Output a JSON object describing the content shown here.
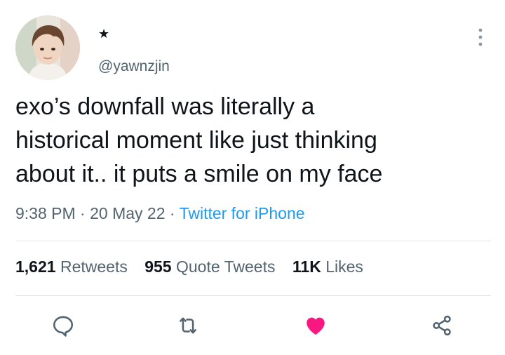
{
  "author": {
    "display_name": "★",
    "handle": "@yawnzjin"
  },
  "tweet": {
    "text_lines": [
      "exo’s downfall was literally a",
      "historical moment like just thinking",
      "about it.. it puts a smile on my face"
    ],
    "time": "9:38 PM",
    "date": "20 May 22",
    "separator": "·",
    "source": "Twitter for iPhone"
  },
  "stats": {
    "retweets": {
      "count": "1,621",
      "label": "Retweets"
    },
    "quote_tweets": {
      "count": "955",
      "label": "Quote Tweets"
    },
    "likes": {
      "count": "11K",
      "label": "Likes"
    }
  },
  "actions": [
    {
      "name": "reply",
      "icon": "reply-icon"
    },
    {
      "name": "retweet",
      "icon": "retweet-icon"
    },
    {
      "name": "like",
      "icon": "heart-icon",
      "liked": true
    },
    {
      "name": "share",
      "icon": "share-icon"
    }
  ],
  "colors": {
    "text": "#0f1419",
    "secondary": "#536471",
    "link": "#1d9bf0",
    "like": "#f91880",
    "divider": "#dfe3e6"
  }
}
